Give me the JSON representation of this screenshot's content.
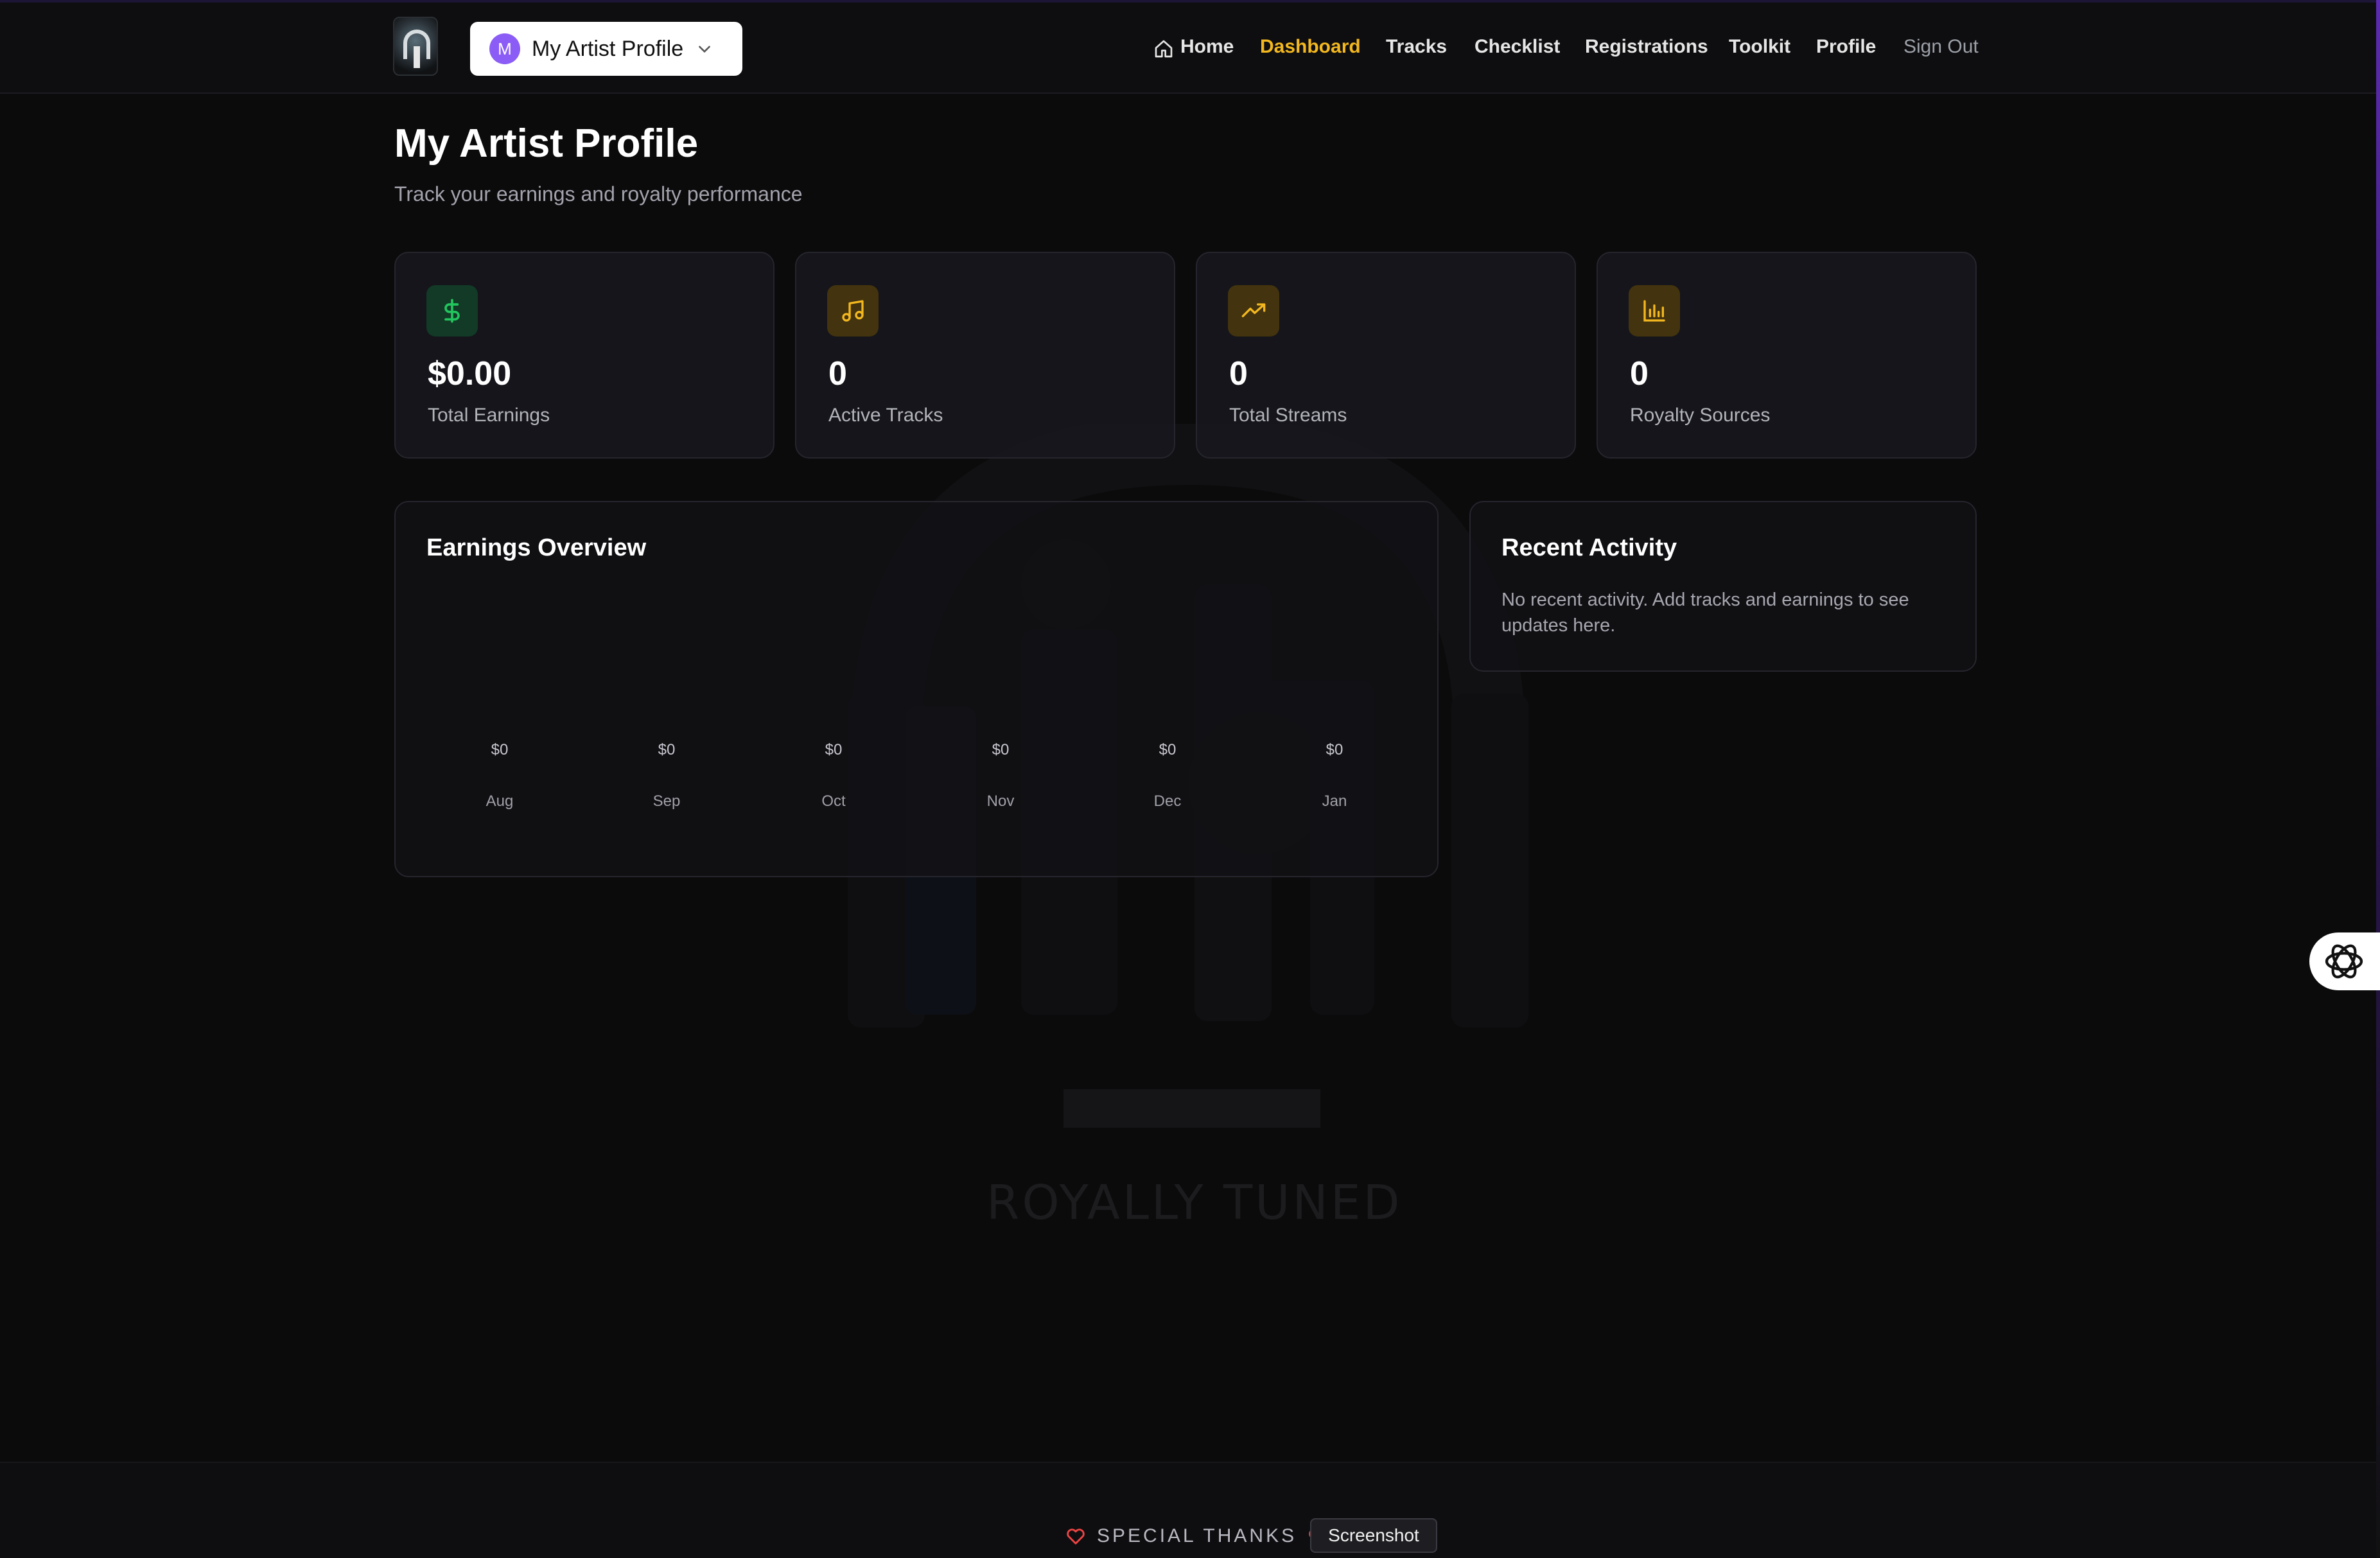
{
  "header": {
    "profile_selector": {
      "avatar_initial": "M",
      "label": "My Artist Profile"
    },
    "nav": [
      {
        "label": "Home"
      },
      {
        "label": "Dashboard",
        "active": true
      },
      {
        "label": "Tracks"
      },
      {
        "label": "Checklist"
      },
      {
        "label": "Registrations"
      },
      {
        "label": "Toolkit"
      },
      {
        "label": "Profile"
      },
      {
        "label": "Sign Out"
      }
    ]
  },
  "page": {
    "title": "My Artist Profile",
    "subtitle": "Track your earnings and royalty performance"
  },
  "stats": [
    {
      "icon": "dollar-icon",
      "value": "$0.00",
      "label": "Total Earnings",
      "color": "#22c55e"
    },
    {
      "icon": "music-note-icon",
      "value": "0",
      "label": "Active Tracks",
      "color": "#f3b81f"
    },
    {
      "icon": "trending-up-icon",
      "value": "0",
      "label": "Total Streams",
      "color": "#f3b81f"
    },
    {
      "icon": "bar-chart-icon",
      "value": "0",
      "label": "Royalty Sources",
      "color": "#f3b81f"
    }
  ],
  "earnings": {
    "title": "Earnings Overview"
  },
  "chart_data": {
    "type": "bar",
    "title": "Earnings Overview",
    "categories": [
      "Aug",
      "Sep",
      "Oct",
      "Nov",
      "Dec",
      "Jan"
    ],
    "values": [
      0,
      0,
      0,
      0,
      0,
      0
    ],
    "value_labels": [
      "$0",
      "$0",
      "$0",
      "$0",
      "$0",
      "$0"
    ]
  },
  "recent_activity": {
    "title": "Recent Activity",
    "empty_text": "No recent activity. Add tracks and earnings to see updates here."
  },
  "watermark": {
    "text": "ROYALLY TUNED"
  },
  "footer": {
    "special_thanks": "SPECIAL THANKS",
    "tooltip": "Screenshot"
  },
  "colors": {
    "background": "#0b0b0c",
    "accent_active_nav": "#f3b81f",
    "avatar": "#8b5cf6",
    "heart": "#ef4444"
  }
}
